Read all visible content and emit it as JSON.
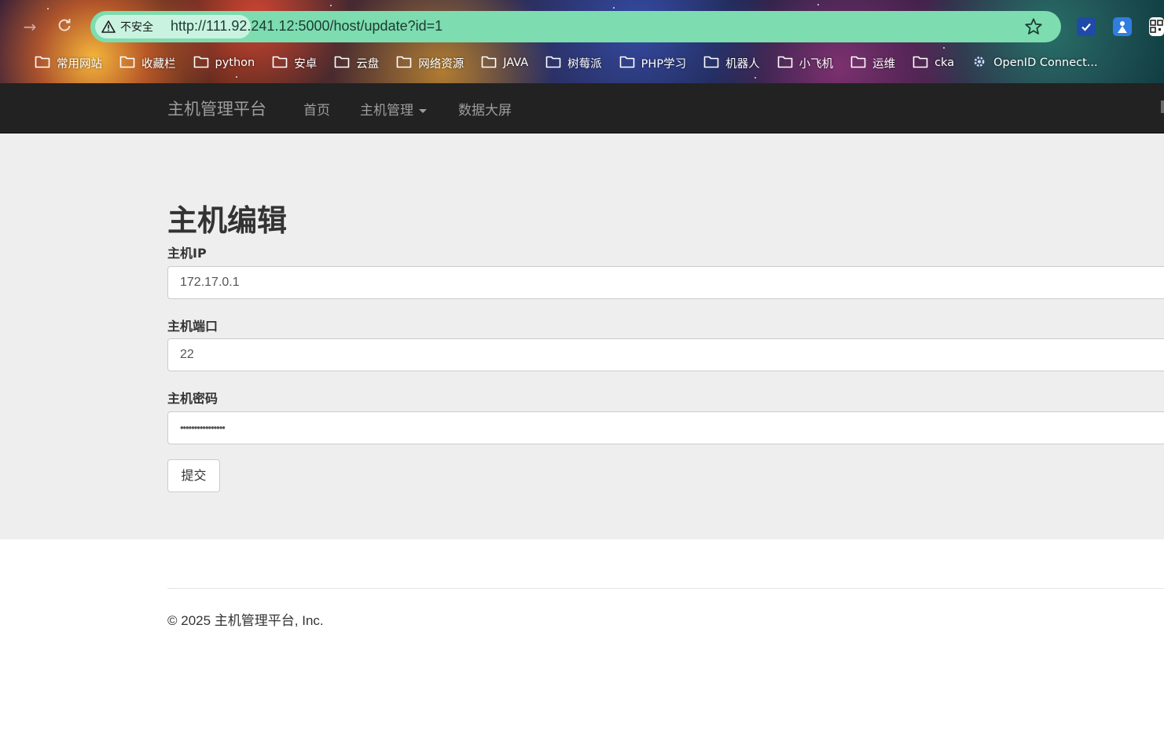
{
  "browser": {
    "security_label": "不安全",
    "url": "http://111.92.241.12:5000/host/update?id=1",
    "bookmarks": [
      {
        "label": "常用网站",
        "icon": "folder-icon"
      },
      {
        "label": "收藏栏",
        "icon": "folder-icon"
      },
      {
        "label": "python",
        "icon": "folder-icon"
      },
      {
        "label": "安卓",
        "icon": "folder-icon"
      },
      {
        "label": "云盘",
        "icon": "folder-icon"
      },
      {
        "label": "网络资源",
        "icon": "folder-icon"
      },
      {
        "label": "JAVA",
        "icon": "folder-icon"
      },
      {
        "label": "树莓派",
        "icon": "folder-icon"
      },
      {
        "label": "PHP学习",
        "icon": "folder-icon"
      },
      {
        "label": "机器人",
        "icon": "folder-icon"
      },
      {
        "label": "小飞机",
        "icon": "folder-icon"
      },
      {
        "label": "运维",
        "icon": "folder-icon"
      },
      {
        "label": "cka",
        "icon": "folder-icon"
      },
      {
        "label": "OpenID Connect...",
        "icon": "gear-icon"
      }
    ]
  },
  "navbar": {
    "brand": "主机管理平台",
    "links": [
      "首页",
      "主机管理",
      "数据大屏"
    ]
  },
  "form": {
    "title": "主机编辑",
    "ip_label": "主机IP",
    "ip_value": "172.17.0.1",
    "port_label": "主机端口",
    "port_value": "22",
    "password_label": "主机密码",
    "password_value": "••••••••••••••••",
    "submit_label": "提交"
  },
  "footer": {
    "text": "© 2025 主机管理平台, Inc."
  },
  "colors": {
    "navbar_bg": "#222222",
    "navbar_text": "#9d9d9d",
    "jumbotron_bg": "#eeeeee",
    "urlbar_bg": "#7ddcb0"
  }
}
